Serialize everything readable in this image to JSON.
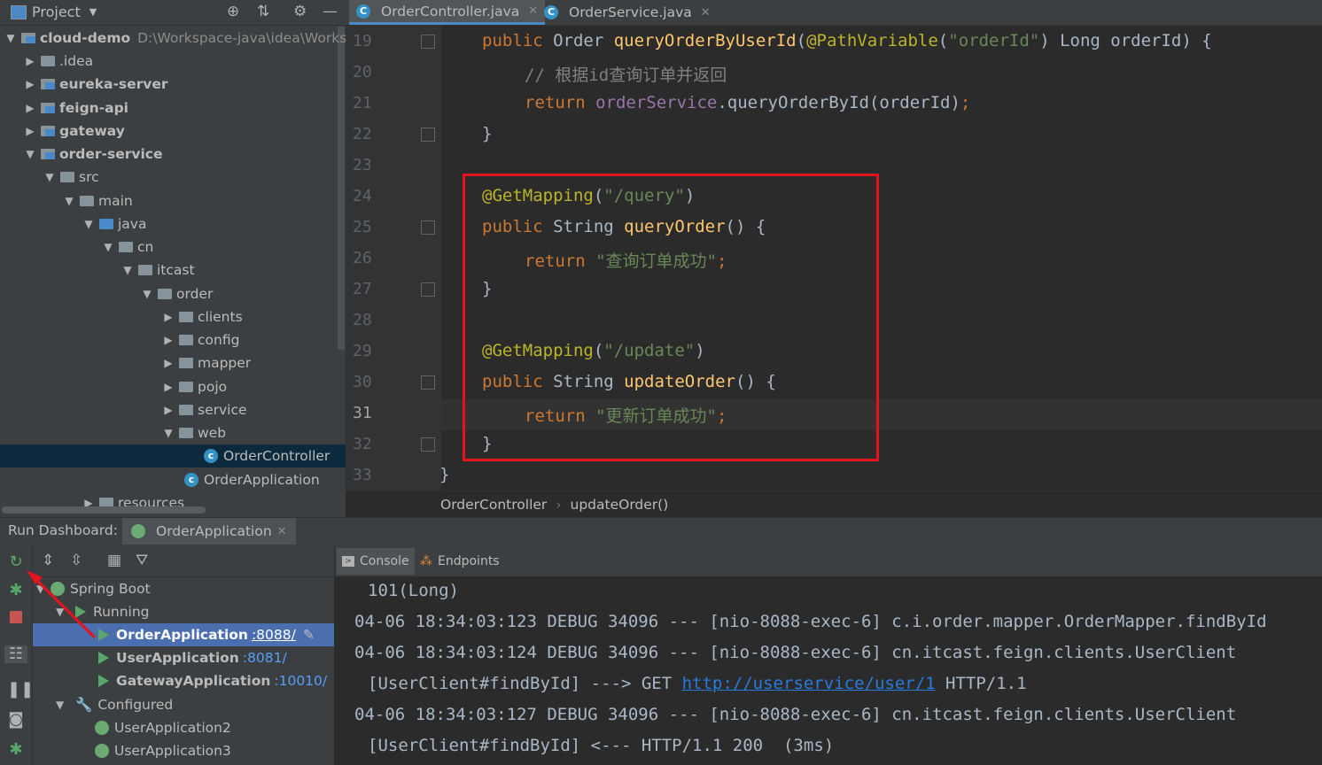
{
  "project": {
    "title": "Project",
    "tree": [
      {
        "label": "cloud-demo",
        "path": "D:\\Workspace-java\\idea\\Workspa"
      },
      {
        "label": ".idea"
      },
      {
        "label": "eureka-server"
      },
      {
        "label": "feign-api"
      },
      {
        "label": "gateway"
      },
      {
        "label": "order-service"
      },
      {
        "label": "src"
      },
      {
        "label": "main"
      },
      {
        "label": "java"
      },
      {
        "label": "cn"
      },
      {
        "label": "itcast"
      },
      {
        "label": "order"
      },
      {
        "label": "clients"
      },
      {
        "label": "config"
      },
      {
        "label": "mapper"
      },
      {
        "label": "pojo"
      },
      {
        "label": "service"
      },
      {
        "label": "web"
      },
      {
        "label": "OrderController"
      },
      {
        "label": "OrderApplication"
      },
      {
        "label": "resources"
      }
    ]
  },
  "editor": {
    "tabs": [
      {
        "label": "OrderController.java",
        "icon": "C"
      },
      {
        "label": "OrderService.java",
        "icon": "C"
      }
    ],
    "line_numbers": [
      "19",
      "20",
      "21",
      "22",
      "23",
      "24",
      "25",
      "26",
      "27",
      "28",
      "29",
      "30",
      "31",
      "32",
      "33"
    ],
    "code": {
      "l19_kw": "public ",
      "l19_type": "Order ",
      "l19_fn": "queryOrderByUserId",
      "l19_p1": "(",
      "l19_an": "@PathVariable",
      "l19_p2": "(",
      "l19_str": "\"orderId\"",
      "l19_p3": ") Long orderId) {",
      "l20": "// 根据id查询订单并返回",
      "l21_kw": "return ",
      "l21_field": "orderService",
      "l21_rest": ".queryOrderById(orderId)",
      "l21_semi": ";",
      "l22": "}",
      "l24_an": "@GetMapping",
      "l24_p1": "(",
      "l24_str": "\"/query\"",
      "l24_p2": ")",
      "l25_kw": "public ",
      "l25_type": "String ",
      "l25_fn": "queryOrder",
      "l25_rest": "() {",
      "l26_kw": "return ",
      "l26_str": "\"查询订单成功\"",
      "l26_semi": ";",
      "l27": "}",
      "l29_an": "@GetMapping",
      "l29_p1": "(",
      "l29_str": "\"/update\"",
      "l29_p2": ")",
      "l30_kw": "public ",
      "l30_type": "String ",
      "l30_fn": "updateOrder",
      "l30_rest": "() {",
      "l31_kw": "return ",
      "l31_str": "\"更新订单成功\"",
      "l31_semi": ";",
      "l32": "}",
      "l33": "}"
    },
    "breadcrumb": [
      "OrderController",
      "updateOrder()"
    ]
  },
  "dashboard": {
    "label": "Run Dashboard:",
    "tab": "OrderApplication",
    "tree": {
      "spring_boot": "Spring Boot",
      "running": "Running",
      "apps_running": [
        {
          "name": "OrderApplication",
          "port": ":8088/"
        },
        {
          "name": "UserApplication",
          "port": ":8081/"
        },
        {
          "name": "GatewayApplication",
          "port": ":10010/"
        }
      ],
      "configured": "Configured",
      "apps_configured": [
        "UserApplication2",
        "UserApplication3"
      ]
    }
  },
  "console": {
    "tabs": [
      "Console",
      "Endpoints"
    ],
    "lines": [
      {
        "text": "101(Long)"
      },
      {
        "text": "04-06 18:34:03:123 DEBUG 34096 --- [nio-8088-exec-6] c.i.order.mapper.OrderMapper.findById"
      },
      {
        "text": "04-06 18:34:03:124 DEBUG 34096 --- [nio-8088-exec-6] cn.itcast.feign.clients.UserClient"
      },
      {
        "pre": "[UserClient#findById] ---> GET ",
        "link": "http://userservice/user/1",
        "post": " HTTP/1.1"
      },
      {
        "text": "04-06 18:34:03:127 DEBUG 34096 --- [nio-8088-exec-6] cn.itcast.feign.clients.UserClient"
      },
      {
        "text": "[UserClient#findById] <--- HTTP/1.1 200  (3ms)"
      }
    ]
  },
  "colors": {
    "highlight_box": "#e3141d",
    "annotation_arrow": "#e3141d"
  }
}
